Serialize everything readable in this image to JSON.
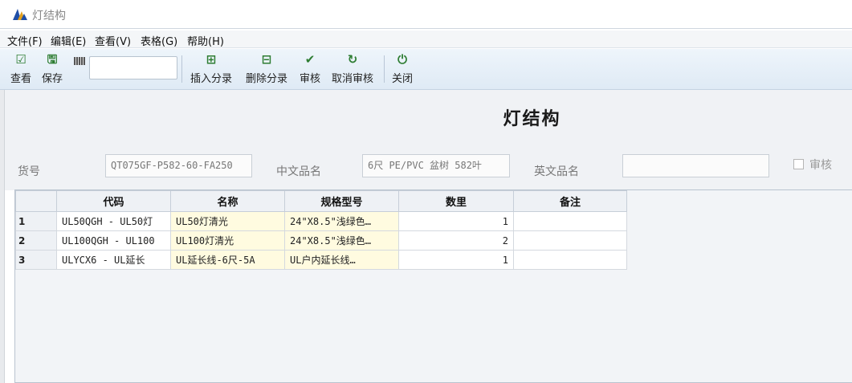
{
  "window": {
    "title": "灯结构"
  },
  "menu": [
    "文件(F)",
    "编辑(E)",
    "查看(V)",
    "表格(G)",
    "帮助(H)"
  ],
  "toolbar": {
    "view": "查看",
    "save": "保存",
    "barcode_value": "",
    "insert_row": "插入分录",
    "delete_row": "删除分录",
    "approve": "审核",
    "cancel_approve": "取消审核",
    "close": "关闭"
  },
  "form": {
    "title": "灯结构",
    "item_no_label": "货号",
    "item_no_value": "QT075GF-P582-60-FA250",
    "cn_name_label": "中文品名",
    "cn_name_value": "6尺 PE/PVC 盆树 582叶",
    "en_name_label": "英文品名",
    "en_name_value": "",
    "approved_label": "审核",
    "approved": false
  },
  "grid": {
    "columns": [
      "",
      "代码",
      "名称",
      "规格型号",
      "数里",
      "备注"
    ],
    "rows": [
      {
        "n": "1",
        "code": "UL50QGH - UL50灯",
        "name": "UL50灯清光",
        "spec": "24\"X8.5\"浅绿色…",
        "qty": "1",
        "note": ""
      },
      {
        "n": "2",
        "code": "UL100QGH - UL100",
        "name": "UL100灯清光",
        "spec": "24\"X8.5\"浅绿色…",
        "qty": "2",
        "note": ""
      },
      {
        "n": "3",
        "code": "ULYCX6 - UL延长",
        "name": "UL延长线-6尺-5A",
        "spec": "UL户内延长线…",
        "qty": "1",
        "note": ""
      }
    ]
  },
  "colors": {
    "toolbar_icon": "#2e7d32",
    "highlight_cell": "#fffbe0"
  }
}
